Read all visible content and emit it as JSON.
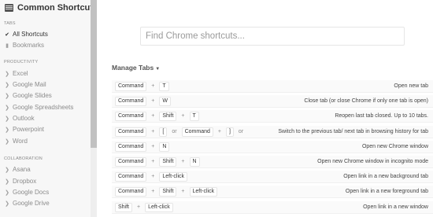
{
  "app": {
    "title": "Common Shortcuts"
  },
  "sidebar": {
    "tabs": {
      "title": "TABS",
      "items": [
        {
          "label": "All Shortcuts",
          "icon": "check-icon",
          "active": true
        },
        {
          "label": "Bookmarks",
          "icon": "bookmark-icon",
          "active": false
        }
      ]
    },
    "productivity": {
      "title": "PRODUCTIVITY",
      "items": [
        {
          "label": "Excel"
        },
        {
          "label": "Google Mail"
        },
        {
          "label": "Google Slides"
        },
        {
          "label": "Google Spreadsheets"
        },
        {
          "label": "Outlook"
        },
        {
          "label": "Powerpoint"
        },
        {
          "label": "Word"
        }
      ]
    },
    "collaboration": {
      "title": "COLLABORATION",
      "items": [
        {
          "label": "Asana"
        },
        {
          "label": "Dropbox"
        },
        {
          "label": "Google Docs"
        },
        {
          "label": "Google Drive"
        }
      ]
    }
  },
  "search": {
    "placeholder": "Find Chrome shortcuts..."
  },
  "group": {
    "title": "Manage Tabs"
  },
  "shortcuts": [
    {
      "keys": [
        "Command",
        "+",
        "T"
      ],
      "desc": "Open new tab"
    },
    {
      "keys": [
        "Command",
        "+",
        "W"
      ],
      "desc": "Close tab (or close Chrome if only one tab is open)"
    },
    {
      "keys": [
        "Command",
        "+",
        "Shift",
        "+",
        "T"
      ],
      "desc": "Reopen last tab closed. Up to 10 tabs."
    },
    {
      "keys": [
        "Command",
        "+",
        "[",
        "or",
        "Command",
        "+",
        "]",
        "or"
      ],
      "desc": "Switch to the previous tab/ next tab in browsing history for tab"
    },
    {
      "keys": [
        "Command",
        "+",
        "N"
      ],
      "desc": "Open new Chrome window"
    },
    {
      "keys": [
        "Command",
        "+",
        "Shift",
        "+",
        "N"
      ],
      "desc": "Open new Chrome window in incognito mode"
    },
    {
      "keys": [
        "Command",
        "+",
        "Left-click"
      ],
      "desc": "Open link in a new background tab"
    },
    {
      "keys": [
        "Command",
        "+",
        "Shift",
        "+",
        "Left-click"
      ],
      "desc": "Open link in a new foreground tab"
    },
    {
      "keys": [
        "Shift",
        "+",
        "Left-click"
      ],
      "desc": "Open link in a new window"
    }
  ]
}
